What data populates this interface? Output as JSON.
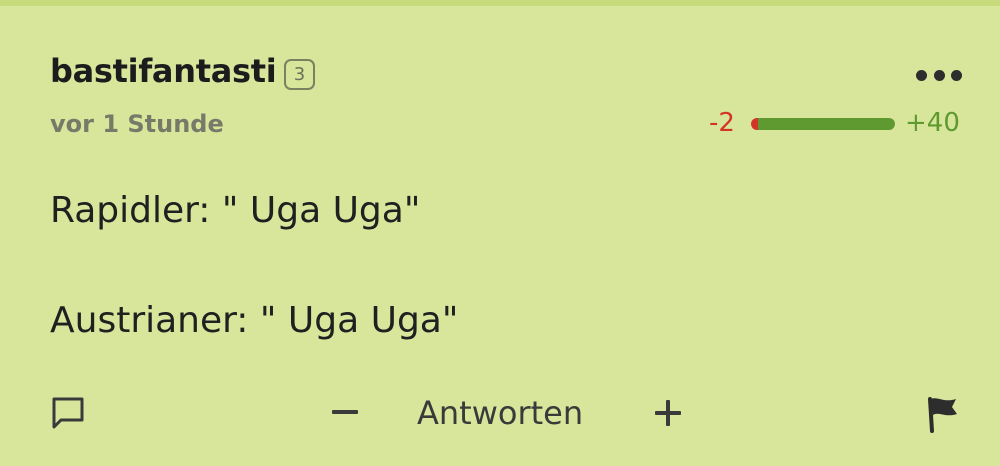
{
  "comment": {
    "username": "bastifantasti",
    "rank_badge": "3",
    "timestamp": "vor 1 Stunde",
    "votes": {
      "negative_label": "-2",
      "positive_label": "+40",
      "negative_share": 0.05,
      "positive_share": 0.95,
      "negative_color": "#d43327",
      "positive_color": "#5f9a30"
    },
    "body_lines": [
      "Rapidler: \" Uga Uga\"",
      "Austrianer: \" Uga Uga\""
    ],
    "actions": {
      "reply_icon": "speech-bubble-icon",
      "downvote_icon": "minus-icon",
      "reply_label": "Antworten",
      "upvote_icon": "plus-icon",
      "report_icon": "flag-icon",
      "more_icon": "more-dots-icon"
    }
  },
  "colors": {
    "background": "#d8e69c"
  }
}
